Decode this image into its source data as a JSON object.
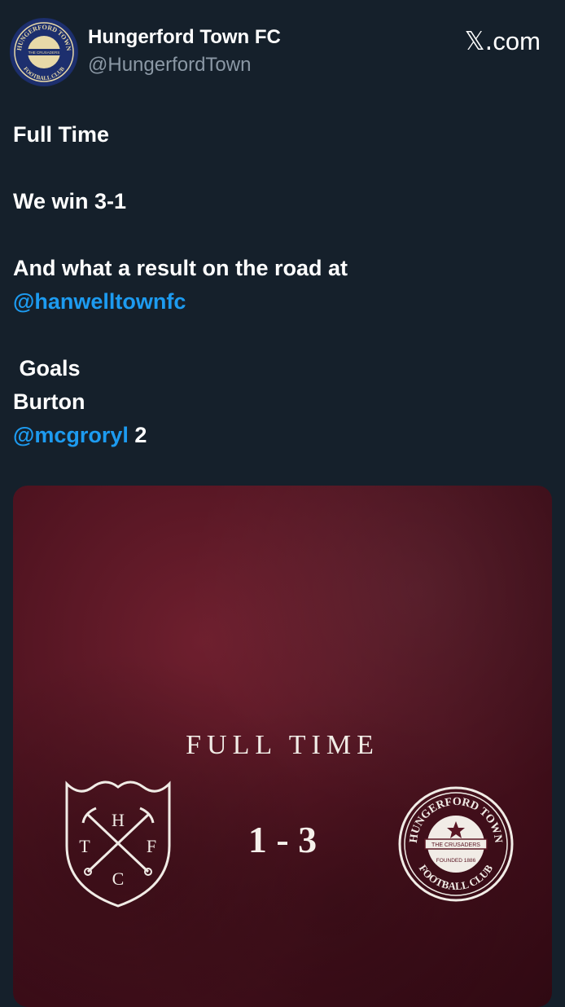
{
  "header": {
    "account_name": "Hungerford Town FC",
    "account_handle": "@HungerfordTown",
    "source_label": "com",
    "source_glyph": "𝕏.",
    "avatar_arc_top": "HUNGERFORD TOWN",
    "avatar_arc_bottom": "FOOTBALL CLUB",
    "avatar_center": "THE CRUSADERS"
  },
  "tweet": {
    "line_1": "Full Time",
    "line_2": "We win 3-1",
    "line_3": "And what a result on the road at",
    "line_4_mention": "@hanwelltownfc",
    "line_5": " Goals",
    "line_6": "Burton",
    "line_7_mention": "@mcgroryl",
    "line_7_rest": " 2"
  },
  "graphic": {
    "heading": "FULL TIME",
    "score": "1 - 3",
    "home_letters": [
      "H",
      "T",
      "F",
      "C"
    ],
    "away_arc_top": "HUNGERFORD TOWN",
    "away_arc_bottom": "FOOTBALL CLUB",
    "away_banner": "THE CRUSADERS",
    "away_founded": "FOUNDED 1886"
  },
  "colors": {
    "background": "#15202b",
    "mention": "#1d9bf0",
    "handle": "#8b98a5",
    "graphic_bg": "#4f1320"
  }
}
